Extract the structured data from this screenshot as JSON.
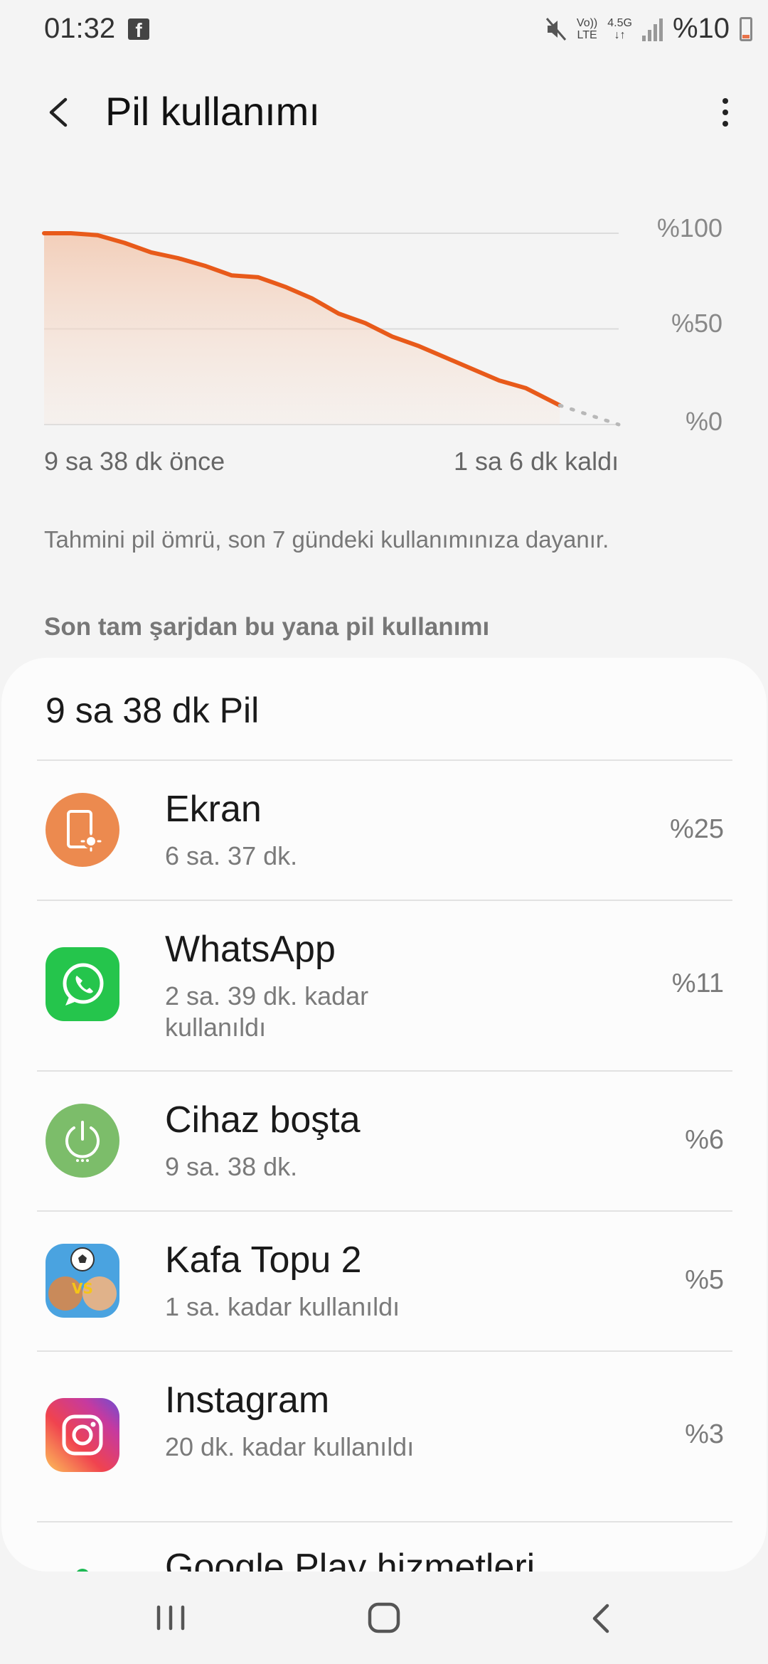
{
  "status_bar": {
    "time": "01:32",
    "network_top": "Vo))",
    "network_bottom": "LTE",
    "data_top": "4.5G",
    "data_bottom": "↓↑",
    "battery_text": "%10"
  },
  "header": {
    "title": "Pil kullanımı"
  },
  "chart_data": {
    "type": "area",
    "x_start_label": "9 sa 38 dk önce",
    "x_end_label": "1 sa 6 dk kaldı",
    "y_ticks": [
      "%100",
      "%50",
      "%0"
    ],
    "ylim": [
      0,
      100
    ],
    "grid": true,
    "x": [
      0,
      0.5,
      1,
      1.5,
      2,
      2.5,
      3,
      3.5,
      4,
      4.5,
      5,
      5.5,
      6,
      6.5,
      7,
      7.5,
      8,
      8.5,
      9,
      9.63
    ],
    "values": [
      100,
      100,
      99,
      95,
      90,
      87,
      83,
      78,
      77,
      72,
      66,
      58,
      53,
      46,
      41,
      35,
      29,
      23,
      19,
      10
    ],
    "projection": {
      "x": [
        9.63,
        10.73
      ],
      "values": [
        10,
        0
      ]
    },
    "accent_color": "#e85a1a"
  },
  "note": "Tahmini pil ömrü, son 7 gündeki kullanımınıza dayanır.",
  "section_title": "Son tam şarjdan bu yana pil kullanımı",
  "usage": {
    "total": "9 sa 38 dk Pil",
    "items": [
      {
        "name": "Ekran",
        "sub": "6 sa. 37 dk.",
        "pct": "%25",
        "icon": "screen-brightness-icon"
      },
      {
        "name": "WhatsApp",
        "sub": "2 sa. 39 dk. kadar kullanıldı",
        "pct": "%11",
        "icon": "whatsapp-icon"
      },
      {
        "name": "Cihaz boşta",
        "sub": "9 sa. 38 dk.",
        "pct": "%6",
        "icon": "power-idle-icon"
      },
      {
        "name": "Kafa Topu 2",
        "sub": "1 sa. kadar kullanıldı",
        "pct": "%5",
        "icon": "kafa-topu-icon"
      },
      {
        "name": "Instagram",
        "sub": "20 dk. kadar kullanıldı",
        "pct": "%3",
        "icon": "instagram-icon"
      },
      {
        "name": "Google Play hizmetleri",
        "sub": "",
        "pct": "",
        "icon": "google-play-services-icon"
      }
    ]
  }
}
